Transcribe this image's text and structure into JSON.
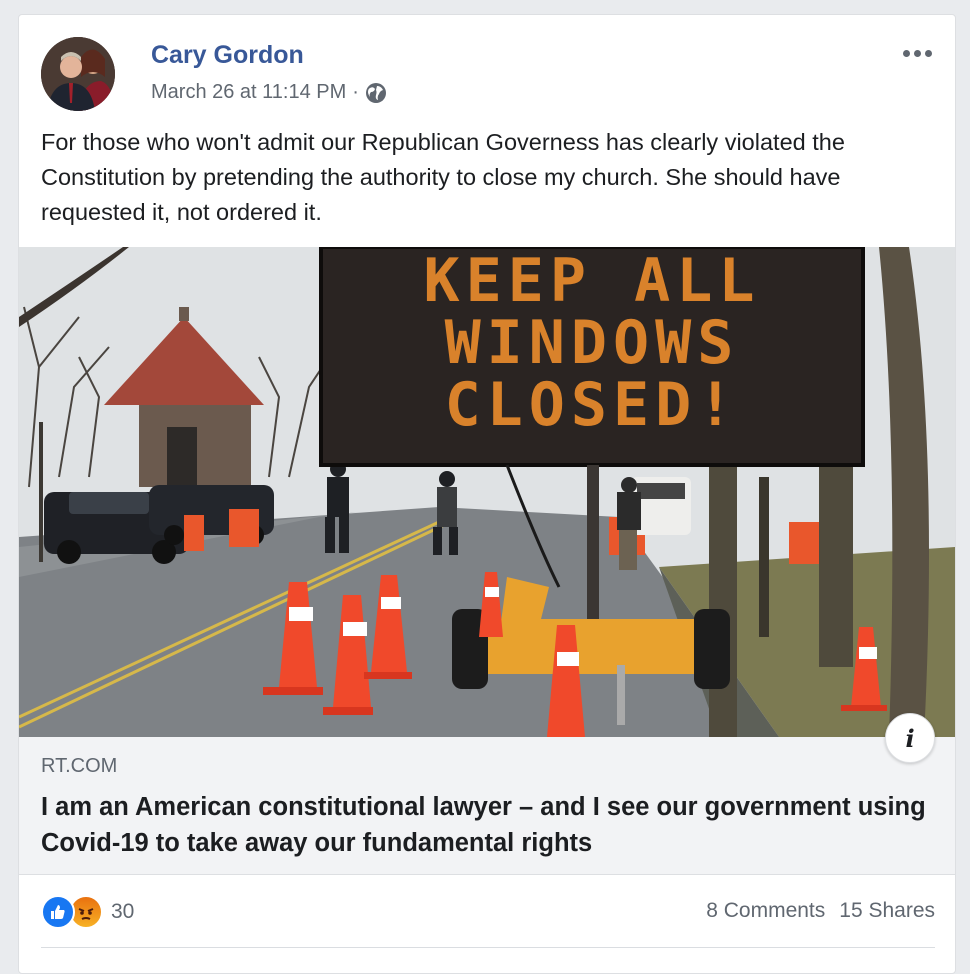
{
  "post": {
    "author": "Cary Gordon",
    "timestamp": "March 26 at 11:14 PM",
    "separator": "·",
    "privacy_icon": "globe-icon",
    "more_icon": "more-options-icon",
    "text": "For those who won't admit our Republican Governess has clearly violated the Constitution by pretending the authority to close my church. She should have requested it, not ordered it."
  },
  "image": {
    "sign_lines": [
      "KEEP ALL",
      "WINDOWS",
      "CLOSED!"
    ]
  },
  "link": {
    "domain": "RT.COM",
    "title": "I am an American constitutional lawyer – and I see our government using Covid-19 to take away our fundamental rights",
    "info_label": "i"
  },
  "footer": {
    "reaction_count": "30",
    "comments": "8 Comments",
    "shares": "15 Shares"
  },
  "colors": {
    "author": "#385898",
    "like": "#1877f2",
    "angry": "#e9710f",
    "sign_text": "#d9822b"
  }
}
